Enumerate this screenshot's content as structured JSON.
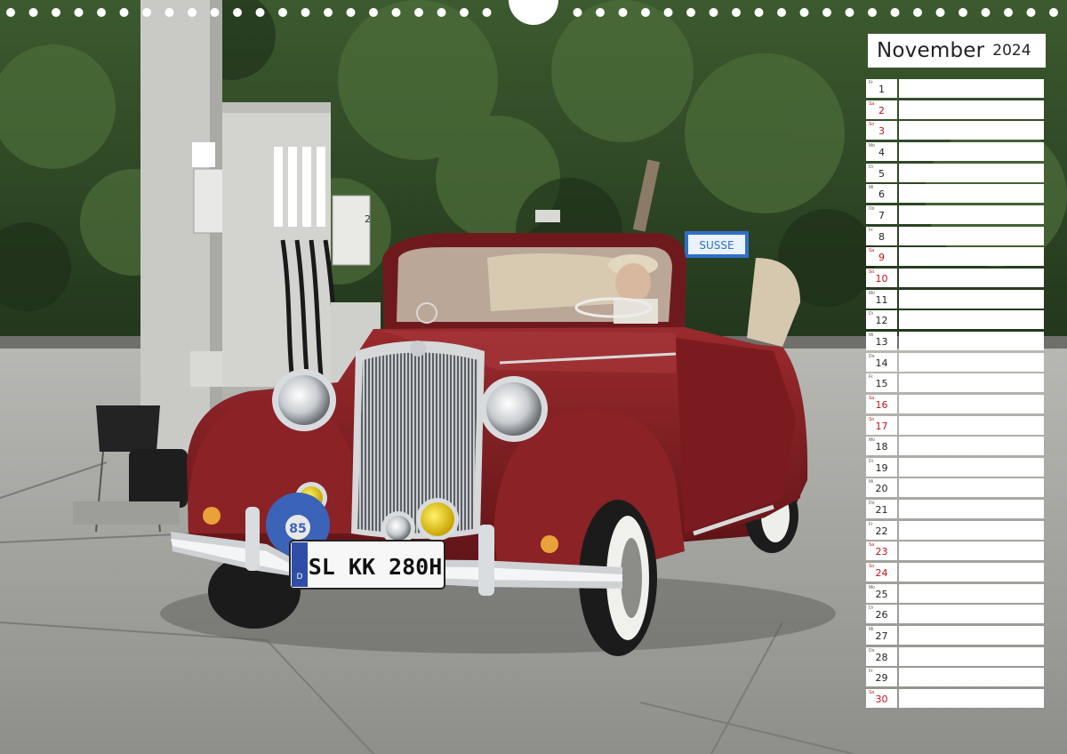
{
  "calendar": {
    "month": "November",
    "year": "2024",
    "days": [
      {
        "wd": "Fr",
        "num": "1",
        "red": false
      },
      {
        "wd": "Sa",
        "num": "2",
        "red": true
      },
      {
        "wd": "So",
        "num": "3",
        "red": true
      },
      {
        "wd": "Mo",
        "num": "4",
        "red": false
      },
      {
        "wd": "Di",
        "num": "5",
        "red": false
      },
      {
        "wd": "Mi",
        "num": "6",
        "red": false
      },
      {
        "wd": "Do",
        "num": "7",
        "red": false
      },
      {
        "wd": "Fr",
        "num": "8",
        "red": false
      },
      {
        "wd": "Sa",
        "num": "9",
        "red": true
      },
      {
        "wd": "So",
        "num": "10",
        "red": true
      },
      {
        "wd": "Mo",
        "num": "11",
        "red": false
      },
      {
        "wd": "Di",
        "num": "12",
        "red": false
      },
      {
        "wd": "Mi",
        "num": "13",
        "red": false
      },
      {
        "wd": "Do",
        "num": "14",
        "red": false
      },
      {
        "wd": "Fr",
        "num": "15",
        "red": false
      },
      {
        "wd": "Sa",
        "num": "16",
        "red": true
      },
      {
        "wd": "So",
        "num": "17",
        "red": true
      },
      {
        "wd": "Mo",
        "num": "18",
        "red": false
      },
      {
        "wd": "Di",
        "num": "19",
        "red": false
      },
      {
        "wd": "Mi",
        "num": "20",
        "red": false
      },
      {
        "wd": "Do",
        "num": "21",
        "red": false
      },
      {
        "wd": "Fr",
        "num": "22",
        "red": false
      },
      {
        "wd": "Sa",
        "num": "23",
        "red": true
      },
      {
        "wd": "So",
        "num": "24",
        "red": true
      },
      {
        "wd": "Mo",
        "num": "25",
        "red": false
      },
      {
        "wd": "Di",
        "num": "26",
        "red": false
      },
      {
        "wd": "Mi",
        "num": "27",
        "red": false
      },
      {
        "wd": "Do",
        "num": "28",
        "red": false
      },
      {
        "wd": "Fr",
        "num": "29",
        "red": false
      },
      {
        "wd": "Sa",
        "num": "30",
        "red": true
      }
    ]
  },
  "photo": {
    "plate": "SL KK 280H",
    "plate_country": "D",
    "pump_number": "2",
    "sign_text": "SUSSE",
    "badge_number": "85"
  },
  "colors": {
    "car_body": "#7a1b1e",
    "weekend_red": "#c0121b",
    "foliage": "#2f4a26"
  }
}
